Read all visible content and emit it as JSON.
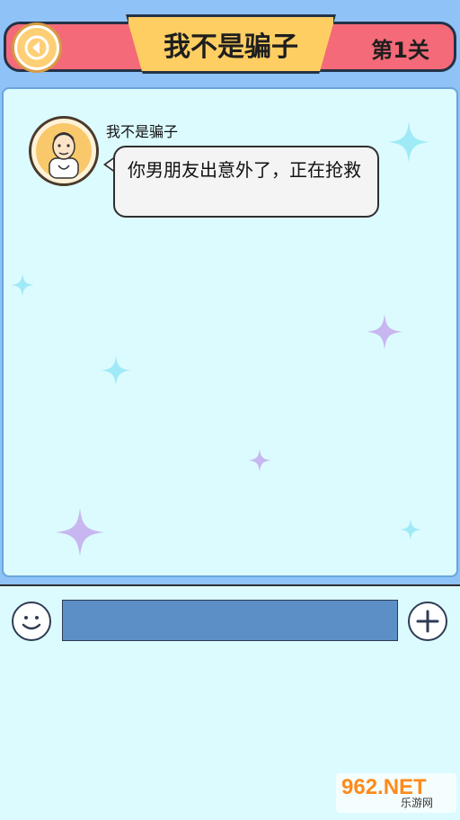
{
  "header": {
    "title": "我不是骗子",
    "level": "第1关",
    "back_icon": "back-arrow-icon"
  },
  "chat": {
    "messages": [
      {
        "sender": "我不是骗子",
        "text": "你男朋友出意外了，正在抢救",
        "avatar_icon": "doctor-avatar"
      }
    ]
  },
  "composer": {
    "emoji_icon": "smiley-icon",
    "plus_icon": "plus-icon",
    "input_value": "",
    "input_placeholder": ""
  },
  "watermark": {
    "logo": "962.NET",
    "subtitle": "乐游网"
  },
  "colors": {
    "sky": "#8fc2f7",
    "ribbon": "#f46a78",
    "plate": "#ffce63",
    "panel": "#dcfbff",
    "input": "#5b8fc6",
    "sparkle_cyan": "#9eeaf7",
    "sparkle_purple": "#c8b6f0"
  }
}
